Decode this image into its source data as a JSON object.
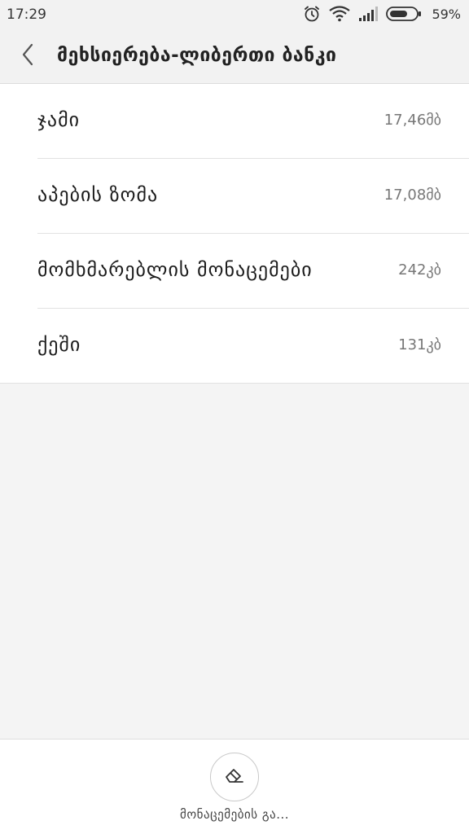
{
  "status_bar": {
    "time": "17:29",
    "battery_percent": "59%",
    "icons": [
      "alarm-icon",
      "wifi-icon",
      "signal-icon",
      "battery-icon"
    ]
  },
  "header": {
    "back_icon": "chevron-left-icon",
    "title": "მეხსიერება-ლიბერთი ბანკი"
  },
  "storage_items": [
    {
      "label": "ჯამი",
      "value": "17,46მბ"
    },
    {
      "label": "აპების ზომა",
      "value": "17,08მბ"
    },
    {
      "label": "მომხმარებლის მონაცემები",
      "value": "242კბ"
    },
    {
      "label": "ქეში",
      "value": "131კბ"
    }
  ],
  "bottom_action": {
    "icon": "eraser-icon",
    "label": "მონაცემების გა..."
  }
}
